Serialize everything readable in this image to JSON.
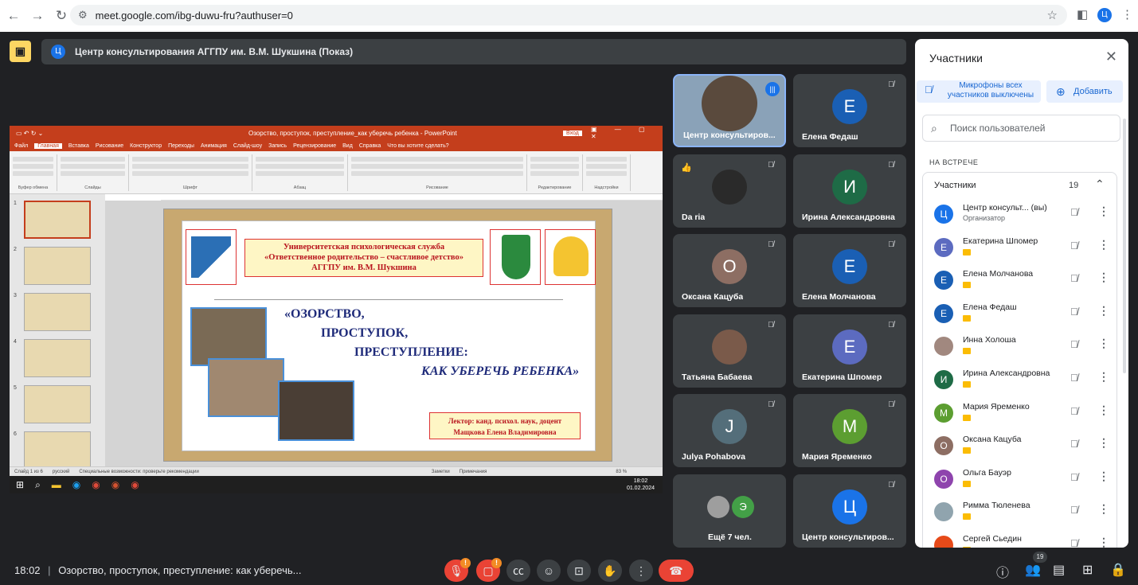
{
  "browser": {
    "url": "meet.google.com/ibg-duwu-fru?authuser=0",
    "profile_initial": "Ц"
  },
  "meeting": {
    "presenter_initial": "Ц",
    "presenter_title": "Центр консультирования АГГПУ им. В.М. Шукшина (Показ)",
    "time": "18:02",
    "title": "Озорство, проступок, преступление: как уберечь..."
  },
  "screen": {
    "pp_title": "Озорство, проступок, преступление_как уберечь ребенка - PowerPoint",
    "pp_login": "Вход",
    "menu": [
      "Файл",
      "Главная",
      "Вставка",
      "Рисование",
      "Конструктор",
      "Переходы",
      "Анимация",
      "Слайд-шоу",
      "Запись",
      "Рецензирование",
      "Вид",
      "Справка",
      "Что вы хотите сделать?"
    ],
    "ribbon_groups": [
      "Буфер обмена",
      "Слайды",
      "Шрифт",
      "Абзац",
      "Рисование",
      "Редактирование",
      "Надстройки"
    ],
    "slide_numbers": [
      "1",
      "2",
      "3",
      "4",
      "5",
      "6"
    ],
    "slide": {
      "uni_line1": "Университетская психологическая служба",
      "uni_line2": "«Ответственное родительство – счастливое детство»",
      "uni_line3": "АГГПУ им. В.М. Шукшина",
      "title1": "«ОЗОРСТВО,",
      "title2": "ПРОСТУПОК,",
      "title3": "ПРЕСТУПЛЕНИЕ:",
      "title4": "КАК УБЕРЕЧЬ РЕБЕНКА»",
      "lecturer1": "Лектор: канд. психол. наук, доцент",
      "lecturer2": "Мащкова Елена Владимировна"
    },
    "status_slide": "Слайд 1 из 6",
    "status_lang": "русский",
    "status_access": "Специальные возможности: проверьте рекомендации",
    "status_notes": "Заметки",
    "status_comments": "Примечания",
    "zoom": "83 %",
    "clock_time": "18:02",
    "clock_date": "01.02.2024"
  },
  "tiles": [
    {
      "name": "Центр консультиров...",
      "initial": "",
      "color": "#5a4a3d"
    },
    {
      "name": "Елена Федаш",
      "initial": "Е",
      "color": "#1a5fb4"
    },
    {
      "name": "Da ria",
      "initial": "",
      "color": "#2a2a2a"
    },
    {
      "name": "Ирина Александровна",
      "initial": "И",
      "color": "#1e6b46"
    },
    {
      "name": "Оксана Кацуба",
      "initial": "О",
      "color": "#8d6e63"
    },
    {
      "name": "Елена Молчанова",
      "initial": "Е",
      "color": "#1a5fb4"
    },
    {
      "name": "Татьяна Бабаева",
      "initial": "",
      "color": "#7a5a4a"
    },
    {
      "name": "Екатерина Шпомер",
      "initial": "Е",
      "color": "#5c6bc0"
    },
    {
      "name": "Julya Pohabova",
      "initial": "J",
      "color": "#546e7a"
    },
    {
      "name": "Мария Яременко",
      "initial": "М",
      "color": "#5c9e31"
    },
    {
      "name": "Ещё 7 чел.",
      "initial": "Э",
      "color": "#43a047"
    },
    {
      "name": "Центр консультиров...",
      "initial": "Ц",
      "color": "#1a73e8"
    }
  ],
  "panel": {
    "title": "Участники",
    "mute_all": "Микрофоны всех участников выключены",
    "add": "Добавить",
    "search_placeholder": "Поиск пользователей",
    "section": "НА ВСТРЕЧЕ",
    "list_label": "Участники",
    "list_count": "19",
    "people": [
      {
        "name": "Центр консульт...  (вы)",
        "sub": "Организатор",
        "initial": "Ц",
        "color": "#1a73e8"
      },
      {
        "name": "Екатерина Шпомер",
        "sub": "",
        "initial": "Е",
        "color": "#5c6bc0"
      },
      {
        "name": "Елена Молчанова",
        "sub": "",
        "initial": "Е",
        "color": "#1a5fb4"
      },
      {
        "name": "Елена Федаш",
        "sub": "",
        "initial": "Е",
        "color": "#1a5fb4"
      },
      {
        "name": "Инна Холоша",
        "sub": "",
        "initial": "",
        "color": "#a1887f"
      },
      {
        "name": "Ирина Александровна",
        "sub": "",
        "initial": "И",
        "color": "#1e6b46"
      },
      {
        "name": "Мария Яременко",
        "sub": "",
        "initial": "М",
        "color": "#5c9e31"
      },
      {
        "name": "Оксана Кацуба",
        "sub": "",
        "initial": "О",
        "color": "#8d6e63"
      },
      {
        "name": "Ольга Бауэр",
        "sub": "",
        "initial": "О",
        "color": "#8e44ad"
      },
      {
        "name": "Римма Тюленева",
        "sub": "",
        "initial": "",
        "color": "#90a4ae"
      },
      {
        "name": "Сергей Сьедин",
        "sub": "",
        "initial": "",
        "color": "#e64a19"
      }
    ]
  },
  "controls": {
    "people_count": "19",
    "warn": "!"
  }
}
